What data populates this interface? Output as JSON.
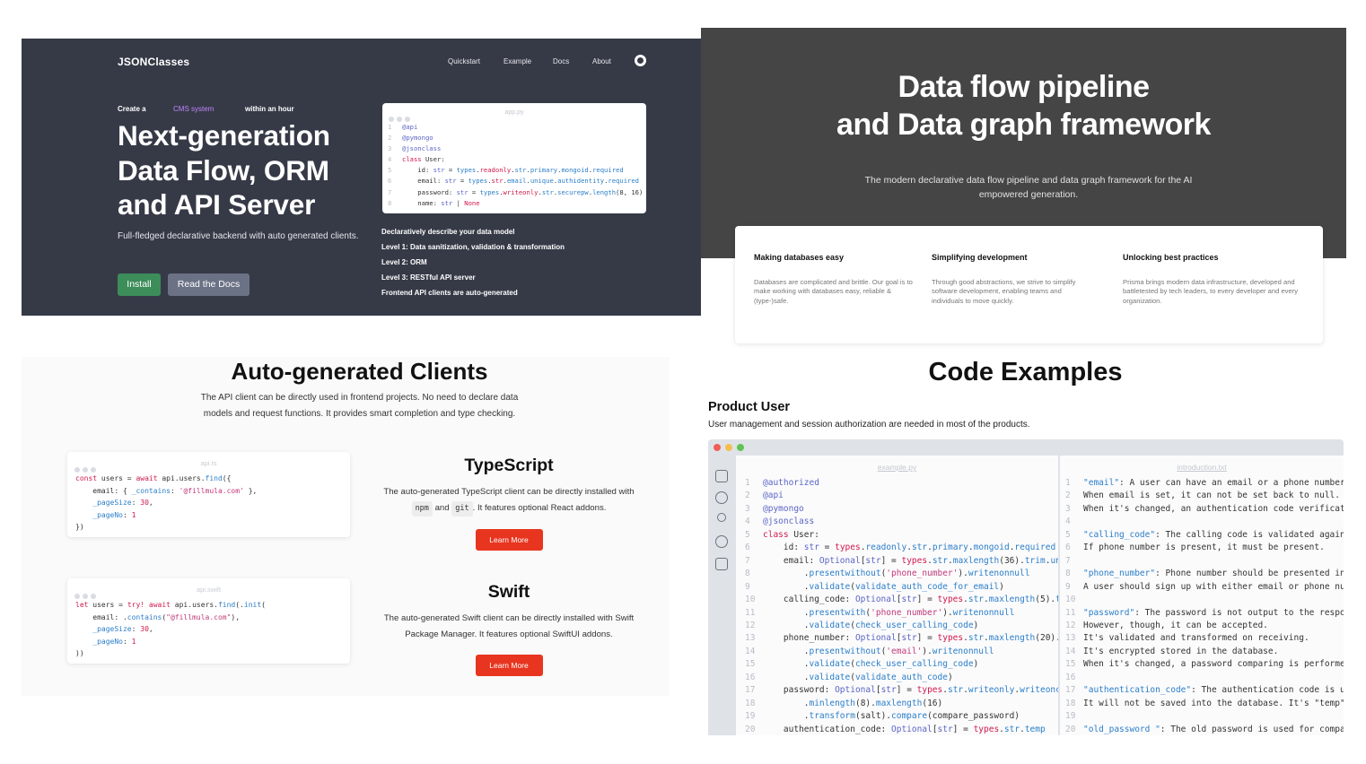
{
  "hero": {
    "brand": "JSONClasses",
    "nav": [
      "Quickstart",
      "Example",
      "Docs",
      "About"
    ],
    "github_icon": "github-icon",
    "create_prefix": "Create a",
    "create_highlight": "CMS system",
    "create_suffix": "within an hour",
    "headline": "Next-generation Data Flow, ORM and API Server",
    "subtitle": "Full-fledged declarative backend with auto generated clients.",
    "install_label": "Install",
    "docs_label": "Read the Docs",
    "code_filename": "app.py",
    "levels": [
      "Declaratively describe your data model",
      "Level 1: Data sanitization, validation & transformation",
      "Level 2: ORM",
      "Level 3: RESTful API server",
      "Frontend API clients are auto-generated"
    ]
  },
  "flow": {
    "title_line1": "Data flow pipeline",
    "title_line2": "and Data graph framework",
    "description": "The modern declarative data flow pipeline and data graph framework for the AI empowered generation.",
    "features": [
      {
        "title": "Making databases easy",
        "text": "Databases are complicated and brittle. Our goal is to make working with databases easy, reliable & (type-)safe."
      },
      {
        "title": "Simplifying development",
        "text": "Through good abstractions, we strive to simplify software development, enabling teams and individuals to move quickly."
      },
      {
        "title": "Unlocking best practices",
        "text": "Prisma brings modern data infrastructure, developed and battletested by tech leaders, to every developer and every organization."
      }
    ]
  },
  "clients": {
    "title": "Auto-generated Clients",
    "description": "The API client can be directly used in frontend projects. No need to declare data models and request functions. It provides smart completion and type checking.",
    "ts_filename": "api.ts",
    "swift_filename": "api.swift",
    "typescript": {
      "title": "TypeScript",
      "text_before": "The auto-generated TypeScript client can be directly installed with",
      "pill1": "npm",
      "and": "and",
      "pill2": "git",
      "text_after": ". It features optional React addons.",
      "button": "Learn More"
    },
    "swift": {
      "title": "Swift",
      "text": "The auto-generated Swift client can be directly installed with Swift Package Manager. It features optional SwiftUI addons.",
      "button": "Learn More"
    }
  },
  "examples": {
    "title": "Code Examples",
    "subtitle": "Product User",
    "subtitle_desc": "User management and session authorization are needed in most of the products.",
    "left_filename": "example.py",
    "right_filename": "introduction.txt",
    "traffic_colors": [
      "#ee5f57",
      "#f5be4f",
      "#5fc453"
    ],
    "sidebar_icons": [
      "files-icon",
      "search-icon",
      "git-branch-icon",
      "debug-icon",
      "extensions-icon"
    ]
  }
}
